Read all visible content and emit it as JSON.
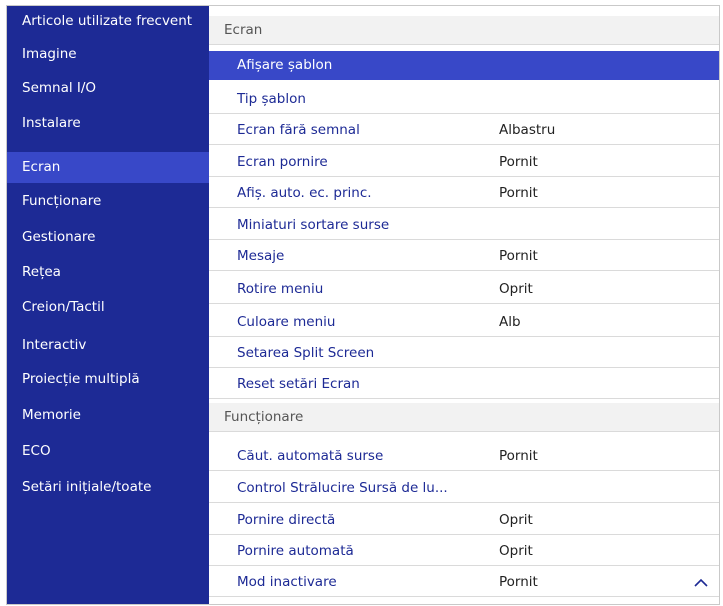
{
  "sidebar": {
    "items": [
      {
        "label": "Articole utilizate frecvent"
      },
      {
        "label": "Imagine"
      },
      {
        "label": "Semnal I/O"
      },
      {
        "label": "Instalare"
      },
      {
        "label": "Ecran",
        "selected": true
      },
      {
        "label": "Funcționare"
      },
      {
        "label": "Gestionare"
      },
      {
        "label": "Rețea"
      },
      {
        "label": "Creion/Tactil"
      },
      {
        "label": "Interactiv"
      },
      {
        "label": "Proiecție multiplă"
      },
      {
        "label": "Memorie"
      },
      {
        "label": "ECO"
      },
      {
        "label": "Setări inițiale/toate"
      }
    ]
  },
  "main": {
    "sections": [
      {
        "title": "Ecran"
      },
      {
        "title": "Funcționare"
      }
    ],
    "ecran_items": [
      {
        "label": "Afișare șablon",
        "value": ""
      },
      {
        "label": "Tip șablon",
        "value": ""
      },
      {
        "label": "Ecran fără semnal",
        "value": "Albastru"
      },
      {
        "label": "Ecran pornire",
        "value": "Pornit"
      },
      {
        "label": "Afiș. auto. ec. princ.",
        "value": "Pornit"
      },
      {
        "label": "Miniaturi sortare surse",
        "value": ""
      },
      {
        "label": "Mesaje",
        "value": "Pornit"
      },
      {
        "label": "Rotire meniu",
        "value": "Oprit"
      },
      {
        "label": "Culoare meniu",
        "value": "Alb"
      },
      {
        "label": "Setarea Split Screen",
        "value": ""
      },
      {
        "label": "Reset setări Ecran",
        "value": ""
      }
    ],
    "functionare_items": [
      {
        "label": "Căut. automată surse",
        "value": "Pornit"
      },
      {
        "label": "Control Strălucire Sursă de lu...",
        "value": ""
      },
      {
        "label": "Pornire directă",
        "value": "Oprit"
      },
      {
        "label": "Pornire automată",
        "value": "Oprit"
      },
      {
        "label": "Mod inactivare",
        "value": "Pornit"
      }
    ]
  },
  "icons": {
    "scroll_up": "chevron-up-icon"
  },
  "colors": {
    "sidebar_bg": "#1d2a95",
    "selected_bg": "#3848c8",
    "text_accent": "#1d2a95",
    "header_bg": "#f2f2f2"
  }
}
